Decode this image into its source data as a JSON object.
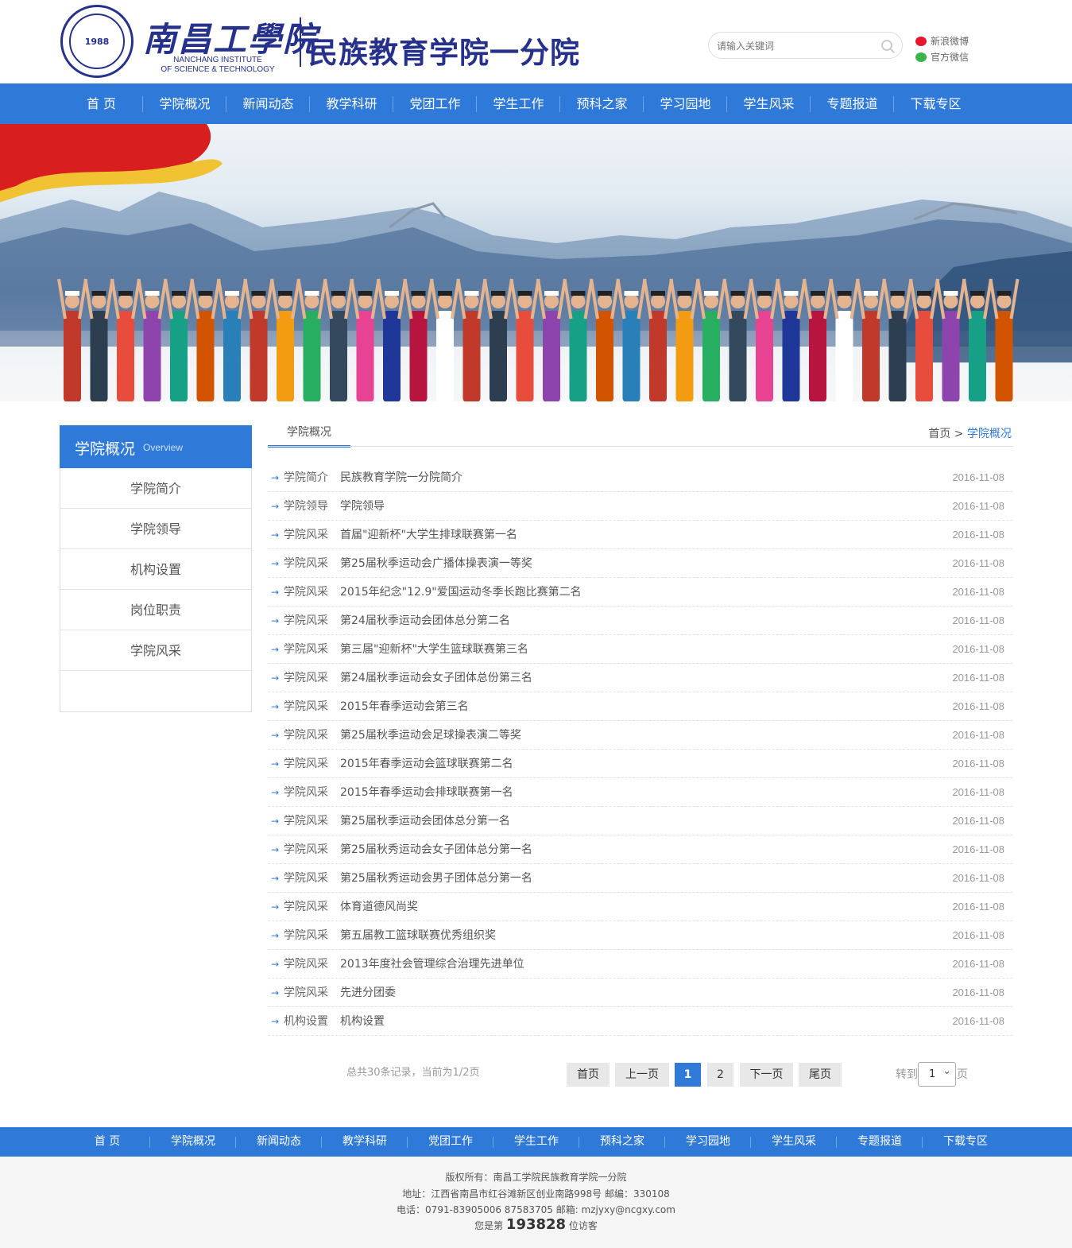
{
  "header": {
    "seal_text": "1988",
    "logo_cn": "南昌工學院",
    "logo_en_line1": "NANCHANG INSTITUTE",
    "logo_en_line2": "OF SCIENCE & TECHNOLOGY",
    "college_name": "民族教育学院一分院",
    "search_placeholder": "请输入关键词",
    "weibo_label": "新浪微博",
    "wechat_label": "官方微信"
  },
  "nav": [
    "首 页",
    "学院概况",
    "新闻动态",
    "教学科研",
    "党团工作",
    "学生工作",
    "预科之家",
    "学习园地",
    "学生风采",
    "专题报道",
    "下载专区"
  ],
  "sidebar": {
    "title": "学院概况",
    "subtitle": "Overview",
    "items": [
      "学院简介",
      "学院领导",
      "机构设置",
      "岗位职责",
      "学院风采"
    ]
  },
  "main": {
    "tab": "学院概况",
    "breadcrumb_home": "首页",
    "breadcrumb_sep": " > ",
    "breadcrumb_current": "学院概况",
    "rows": [
      {
        "cat": "学院简介",
        "title": "民族教育学院一分院简介",
        "date": "2016-11-08"
      },
      {
        "cat": "学院领导",
        "title": "学院领导",
        "date": "2016-11-08"
      },
      {
        "cat": "学院风采",
        "title": "首届\"迎新杯\"大学生排球联赛第一名",
        "date": "2016-11-08"
      },
      {
        "cat": "学院风采",
        "title": "第25届秋季运动会广播体操表演一等奖",
        "date": "2016-11-08"
      },
      {
        "cat": "学院风采",
        "title": "2015年纪念\"12.9\"爱国运动冬季长跑比赛第二名",
        "date": "2016-11-08"
      },
      {
        "cat": "学院风采",
        "title": "第24届秋季运动会团体总分第二名",
        "date": "2016-11-08"
      },
      {
        "cat": "学院风采",
        "title": "第三届\"迎新杯\"大学生篮球联赛第三名",
        "date": "2016-11-08"
      },
      {
        "cat": "学院风采",
        "title": "第24届秋季运动会女子团体总份第三名",
        "date": "2016-11-08"
      },
      {
        "cat": "学院风采",
        "title": "2015年春季运动会第三名",
        "date": "2016-11-08"
      },
      {
        "cat": "学院风采",
        "title": "第25届秋季运动会足球操表演二等奖",
        "date": "2016-11-08"
      },
      {
        "cat": "学院风采",
        "title": "2015年春季运动会篮球联赛第二名",
        "date": "2016-11-08"
      },
      {
        "cat": "学院风采",
        "title": "2015年春季运动会排球联赛第一名",
        "date": "2016-11-08"
      },
      {
        "cat": "学院风采",
        "title": "第25届秋季运动会团体总分第一名",
        "date": "2016-11-08"
      },
      {
        "cat": "学院风采",
        "title": "第25届秋秀运动会女子团体总分第一名",
        "date": "2016-11-08"
      },
      {
        "cat": "学院风采",
        "title": "第25届秋秀运动会男子团体总分第一名",
        "date": "2016-11-08"
      },
      {
        "cat": "学院风采",
        "title": "体育道德风尚奖",
        "date": "2016-11-08"
      },
      {
        "cat": "学院风采",
        "title": "第五届教工篮球联赛优秀组织奖",
        "date": "2016-11-08"
      },
      {
        "cat": "学院风采",
        "title": "2013年度社会管理综合治理先进单位",
        "date": "2016-11-08"
      },
      {
        "cat": "学院风采",
        "title": "先进分团委",
        "date": "2016-11-08"
      },
      {
        "cat": "机构设置",
        "title": "机构设置",
        "date": "2016-11-08"
      }
    ]
  },
  "pager": {
    "info": "总共30条记录，当前为1/2页",
    "first": "首页",
    "prev": "上一页",
    "page1": "1",
    "page2": "2",
    "next": "下一页",
    "last": "尾页",
    "goto_prefix": "转到",
    "goto_value": "1",
    "goto_suffix": "页"
  },
  "footer_nav": [
    "首 页",
    "学院概况",
    "新闻动态",
    "教学科研",
    "党团工作",
    "学生工作",
    "预科之家",
    "学习园地",
    "学生风采",
    "专题报道",
    "下载专区"
  ],
  "footer": {
    "copyright": "版权所有：南昌工学院民族教育学院一分院",
    "address": "地址：江西省南昌市红谷滩新区创业南路998号 邮编：330108",
    "contact": "电话：0791-83905006 87583705 邮箱: mzjyxy@ncgxy.com",
    "visitor_prefix": "您是第",
    "visitor_count": "193828",
    "visitor_suffix": "位访客"
  },
  "colors": {
    "primary": "#2f79d8",
    "brand_navy": "#25318a"
  }
}
